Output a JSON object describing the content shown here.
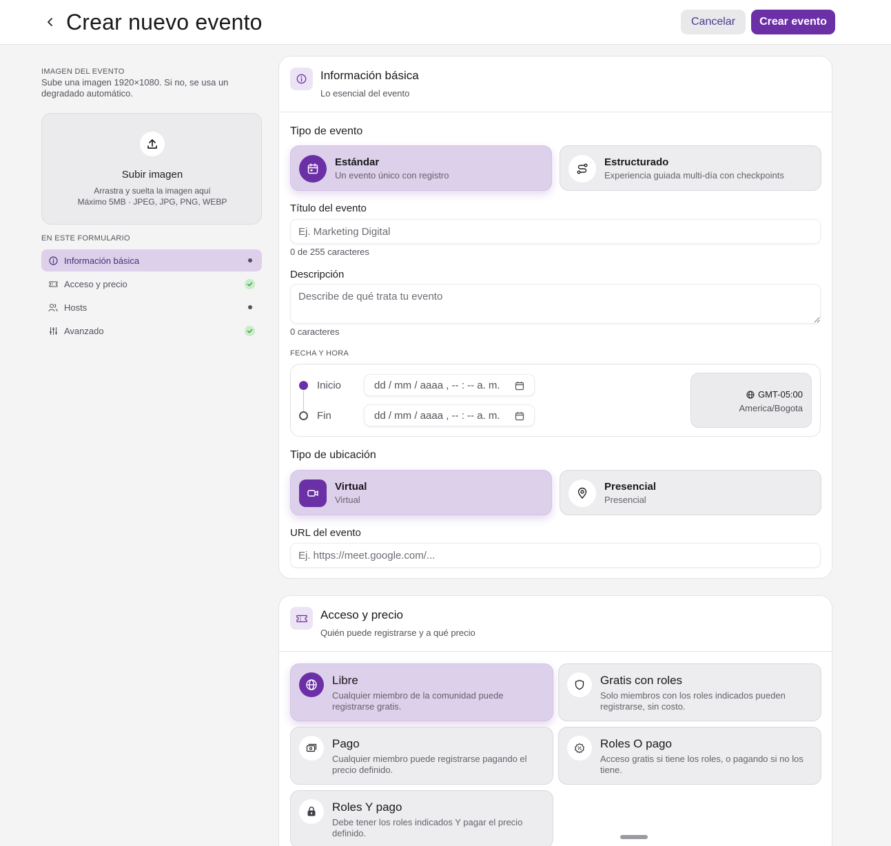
{
  "header": {
    "title": "Crear nuevo evento",
    "cancel_label": "Cancelar",
    "create_label": "Crear evento"
  },
  "sidebar": {
    "image_caption": "IMAGEN DEL EVENTO",
    "image_desc": "Sube una imagen 1920×1080. Si no, se usa un degradado automático.",
    "upload_title": "Subir imagen",
    "upload_line1": "Arrastra y suelta la imagen aquí",
    "upload_line2": "Máximo 5MB · JPEG, JPG, PNG, WEBP",
    "form_caption": "EN ESTE FORMULARIO",
    "items": [
      {
        "label": "Información básica",
        "status": "pending"
      },
      {
        "label": "Acceso y precio",
        "status": "complete"
      },
      {
        "label": "Hosts",
        "status": "pending"
      },
      {
        "label": "Avanzado",
        "status": "complete"
      }
    ]
  },
  "basic": {
    "title": "Información básica",
    "subtitle": "Lo esencial del evento",
    "event_type_label": "Tipo de evento",
    "types": [
      {
        "title": "Estándar",
        "desc": "Un evento único con registro"
      },
      {
        "title": "Estructurado",
        "desc": "Experiencia guiada multi-día con checkpoints"
      }
    ],
    "title_label": "Título del evento",
    "title_placeholder": "Ej. Marketing Digital",
    "title_counter": "0 de 255 caracteres",
    "desc_label": "Descripción",
    "desc_placeholder": "Describe de qué trata tu evento",
    "desc_counter": "0 caracteres",
    "date_caption": "FECHA Y HORA",
    "start_label": "Inicio",
    "end_label": "Fin",
    "date_placeholder": "dd / mm / aaaa , -- : --  a. m.",
    "tz_code": "GMT-05:00",
    "tz_name": "America/Bogota",
    "location_label": "Tipo de ubicación",
    "locations": [
      {
        "title": "Virtual",
        "desc": "Virtual"
      },
      {
        "title": "Presencial",
        "desc": "Presencial"
      }
    ],
    "url_label": "URL del evento",
    "url_placeholder": "Ej. https://meet.google.com/..."
  },
  "access": {
    "title": "Acceso y precio",
    "subtitle": "Quién puede registrarse y a qué precio",
    "options": [
      {
        "title": "Libre",
        "desc": "Cualquier miembro de la comunidad puede registrarse gratis."
      },
      {
        "title": "Gratis con roles",
        "desc": "Solo miembros con los roles indicados pueden registrarse, sin costo."
      },
      {
        "title": "Pago",
        "desc": "Cualquier miembro puede registrarse pagando el precio definido."
      },
      {
        "title": "Roles O pago",
        "desc": "Acceso gratis si tiene los roles, o pagando si no los tiene."
      },
      {
        "title": "Roles Y pago",
        "desc": "Debe tener los roles indicados Y pagar el precio definido."
      }
    ]
  },
  "colors": {
    "accent": "#6b2fa6",
    "selected_bg": "#ddd0ea",
    "complete": "#c9ecc9"
  }
}
